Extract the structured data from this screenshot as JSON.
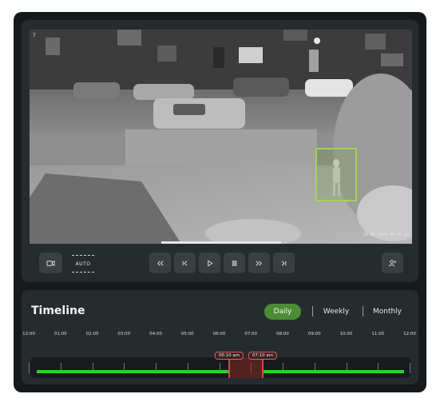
{
  "camera": {
    "feed_label": "7",
    "timestamp": "24.06.2024 06:45:12"
  },
  "controls": {
    "record_icon": "video-camera-icon",
    "auto_label": "AUTO",
    "buttons": [
      "rewind-icon",
      "skip-back-icon",
      "play-icon",
      "pause-icon",
      "fast-forward-icon",
      "skip-forward-icon"
    ],
    "share_icon": "share-person-icon"
  },
  "timeline": {
    "title": "Timeline",
    "tabs": [
      {
        "label": "Daily",
        "active": true
      },
      {
        "label": "Weekly",
        "active": false
      },
      {
        "label": "Monthly",
        "active": false
      }
    ],
    "hours": [
      "12:00",
      "01:00",
      "02:00",
      "03:00",
      "04:00",
      "05:00",
      "06:00",
      "07:00",
      "08:00",
      "09:00",
      "10:00",
      "11:00",
      "12:00"
    ],
    "selection": {
      "start": "06:10 am",
      "end": "07:10 am"
    }
  },
  "colors": {
    "accent": "#4c8c35",
    "recording": "#2fd12f",
    "detection": "#a4d25a",
    "selection": "#c84a48"
  }
}
